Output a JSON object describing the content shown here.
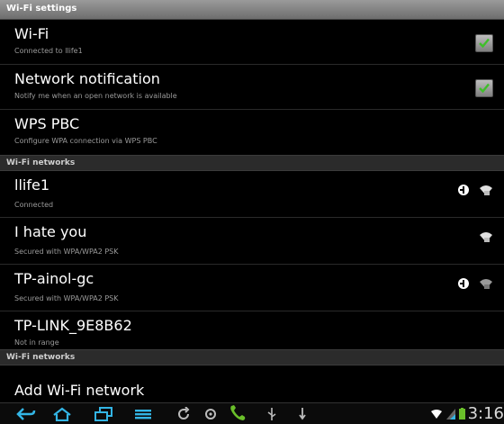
{
  "window": {
    "title": "Wi-Fi settings"
  },
  "settings": [
    {
      "title": "Wi-Fi",
      "subtitle": "Connected to llife1",
      "checked": true
    },
    {
      "title": "Network notification",
      "subtitle": "Notify me when an open network is available",
      "checked": true
    },
    {
      "title": "WPS PBC",
      "subtitle": "Configure WPA connection via WPS PBC"
    }
  ],
  "networks_header": "Wi-Fi networks",
  "networks": [
    {
      "ssid": "llife1",
      "status": "Connected",
      "icons": [
        "wps-icon",
        "wifi-signal-icon"
      ]
    },
    {
      "ssid": "I hate you",
      "status": "Secured with WPA/WPA2 PSK",
      "icons": [
        "wifi-signal-icon"
      ]
    },
    {
      "ssid": "TP-ainol-gc",
      "status": "Secured with WPA/WPA2 PSK",
      "icons": [
        "wps-icon",
        "wifi-signal-icon"
      ]
    },
    {
      "ssid": "TP-LINK_9E8B62",
      "status": "Not in range"
    }
  ],
  "networks_header_2": "Wi-Fi networks",
  "add_network": {
    "label": "Add Wi-Fi network"
  },
  "statusbar": {
    "icons": [
      "back-icon",
      "home-icon",
      "recent-apps-icon",
      "menu-icon",
      "refresh-icon",
      "sync-icon",
      "phone-icon",
      "usb-icon",
      "notification-icon"
    ],
    "clock": "3:16",
    "colors": {
      "accent": "#33b5e5",
      "phone": "#6abf2a"
    }
  }
}
